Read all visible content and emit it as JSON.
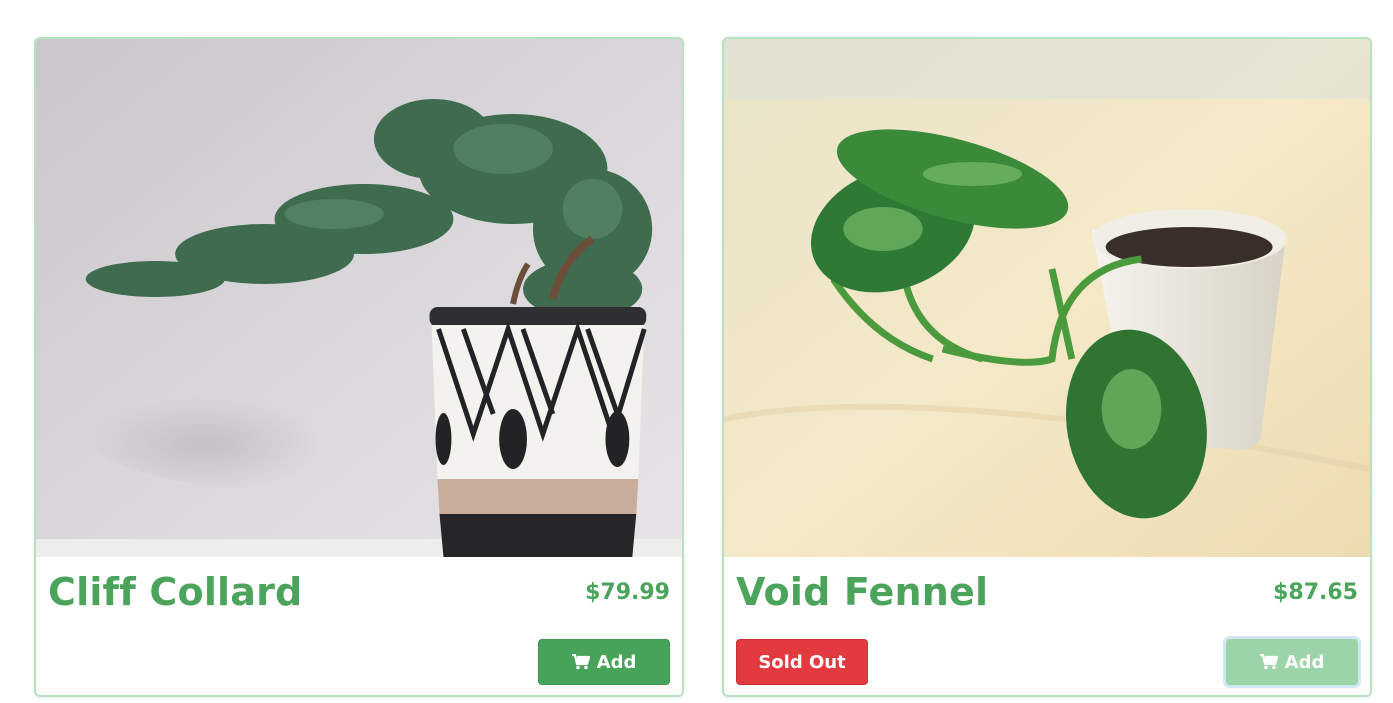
{
  "colors": {
    "accent": "#4ca45c",
    "card_border": "#b6e2c0",
    "add_button": "#48a35a",
    "add_button_disabled": "#9bd4a8",
    "sold_out": "#e23a3f"
  },
  "products": [
    {
      "title": "Cliff Collard",
      "price": "$79.99",
      "add_label": "Add",
      "icon": "cart-icon",
      "sold_out": false
    },
    {
      "title": "Void Fennel",
      "price": "$87.65",
      "add_label": "Add",
      "icon": "cart-icon",
      "sold_out": true,
      "sold_out_label": "Sold Out"
    }
  ]
}
